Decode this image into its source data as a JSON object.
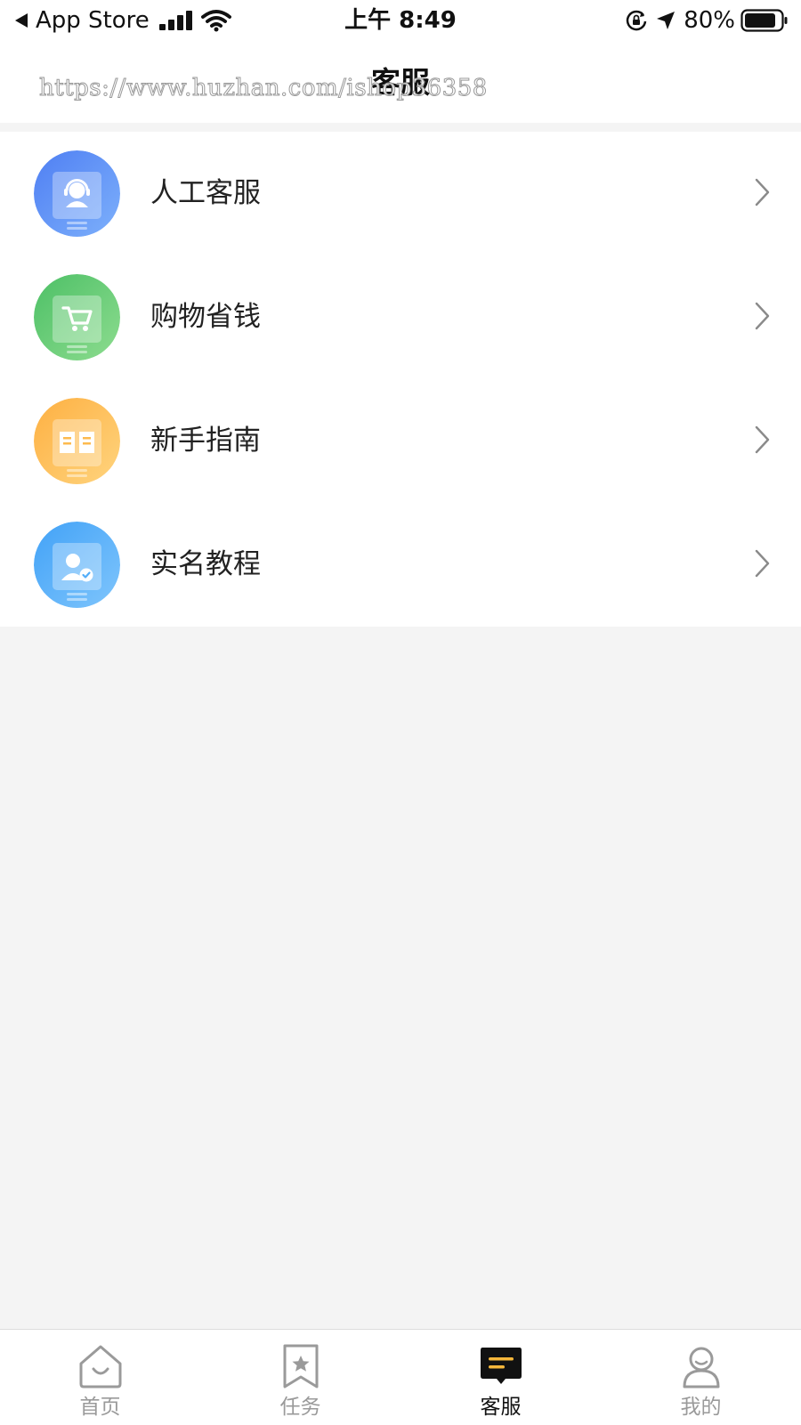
{
  "status_bar": {
    "back_app": "App Store",
    "time": "上午 8:49",
    "battery": "80%"
  },
  "header": {
    "title": "客服",
    "watermark": "https://www.huzhan.com/ishop36358"
  },
  "menu": {
    "items": [
      {
        "label": "人工客服",
        "icon": "customer-service-icon",
        "color": "#5B8FF7"
      },
      {
        "label": "购物省钱",
        "icon": "shopping-cart-icon",
        "color": "#5CCB6E"
      },
      {
        "label": "新手指南",
        "icon": "book-icon",
        "color": "#FDBA4E"
      },
      {
        "label": "实名教程",
        "icon": "verified-user-icon",
        "color": "#54AEF9"
      }
    ]
  },
  "tabbar": {
    "active": "客服",
    "tabs": [
      {
        "label": "首页",
        "icon": "home-icon"
      },
      {
        "label": "任务",
        "icon": "task-bookmark-icon"
      },
      {
        "label": "客服",
        "icon": "chat-icon"
      },
      {
        "label": "我的",
        "icon": "profile-icon"
      }
    ]
  }
}
